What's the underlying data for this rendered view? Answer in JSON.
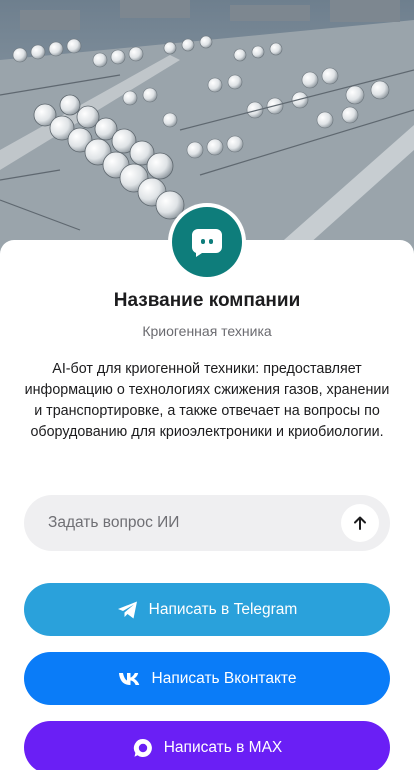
{
  "company": {
    "name": "Название компании",
    "tagline": "Криогенная техника",
    "description": "AI-бот для криогенной техники: предоставляет информацию о технологиях сжижения газов, хранении и транспортировке, а также отвечает на вопросы по оборудованию для криоэлектроники и криобиологии."
  },
  "ask": {
    "placeholder": "Задать вопрос ИИ"
  },
  "buttons": {
    "telegram": "Написать в Telegram",
    "vkontakte": "Написать Вконтакте",
    "max": "Написать в MAX"
  },
  "colors": {
    "avatar": "#0e7d7b",
    "telegram": "#2aa1db",
    "vkontakte": "#0a7cf8",
    "max": "#6a1ff5"
  },
  "icons": {
    "avatar": "chat-bot-icon",
    "send": "arrow-up-icon",
    "telegram": "telegram-icon",
    "vkontakte": "vk-icon",
    "max": "max-icon"
  }
}
